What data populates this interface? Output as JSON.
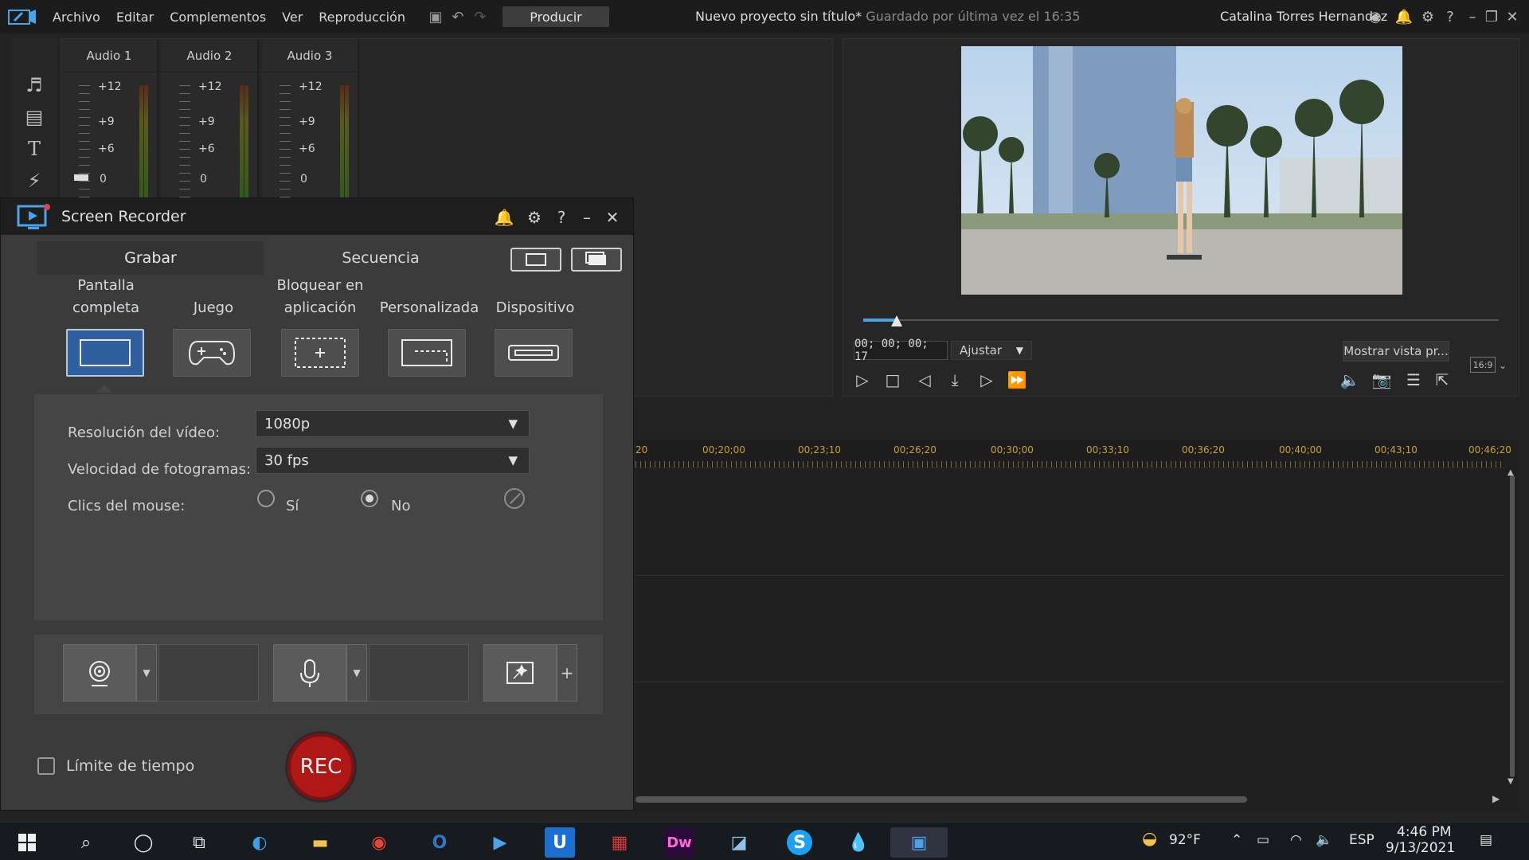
{
  "menubar": {
    "items": [
      "Archivo",
      "Editar",
      "Complementos",
      "Ver",
      "Reproducción"
    ],
    "produce_label": "Producir",
    "project_name": "Nuevo proyecto sin título*",
    "saved_status": "Guardado por última vez el 16:35",
    "user_name": "Catalina Torres Hernandez"
  },
  "mixer": {
    "channels": [
      {
        "label": "Audio 1"
      },
      {
        "label": "Audio 2"
      },
      {
        "label": "Audio 3"
      }
    ],
    "scale": [
      "+12",
      "+9",
      "+6",
      "0"
    ]
  },
  "preview": {
    "timecode": "00; 00; 00; 17",
    "fit_option": "Ajustar",
    "show_preview_label": "Mostrar vista pr...",
    "aspect_ratio": "16:9"
  },
  "timeline": {
    "ruler": [
      "20",
      "00;20;00",
      "00;23;10",
      "00;26;20",
      "00;30;00",
      "00;33;10",
      "00;36;20",
      "00;40;00",
      "00;43;10",
      "00;46;20"
    ]
  },
  "recorder": {
    "title": "Screen Recorder",
    "tabs": {
      "record": "Grabar",
      "sequence": "Secuencia"
    },
    "modes": [
      {
        "label": "Pantalla completa",
        "icon": "fullscreen-icon"
      },
      {
        "label": "Juego",
        "icon": "gamepad-icon"
      },
      {
        "label": "Bloquear en aplicación",
        "icon": "lock-app-icon"
      },
      {
        "label": "Personalizada",
        "icon": "custom-area-icon"
      },
      {
        "label": "Dispositivo",
        "icon": "device-icon"
      }
    ],
    "settings": {
      "resolution_label": "Resolución del vídeo:",
      "resolution_value": "1080p",
      "fps_label": "Velocidad de fotogramas:",
      "fps_value": "30 fps",
      "mouse_label": "Clics del mouse:",
      "mouse_yes": "Sí",
      "mouse_no": "No",
      "mouse_selected": "No"
    },
    "time_limit_label": "Límite de tiempo",
    "rec_label": "REC"
  },
  "taskbar": {
    "weather": "92°F",
    "language": "ESP",
    "time": "4:46 PM",
    "date": "9/13/2021"
  },
  "colors": {
    "accent": "#2f5f9c",
    "rec": "#b01818",
    "ruler_text": "#c8a03a"
  }
}
